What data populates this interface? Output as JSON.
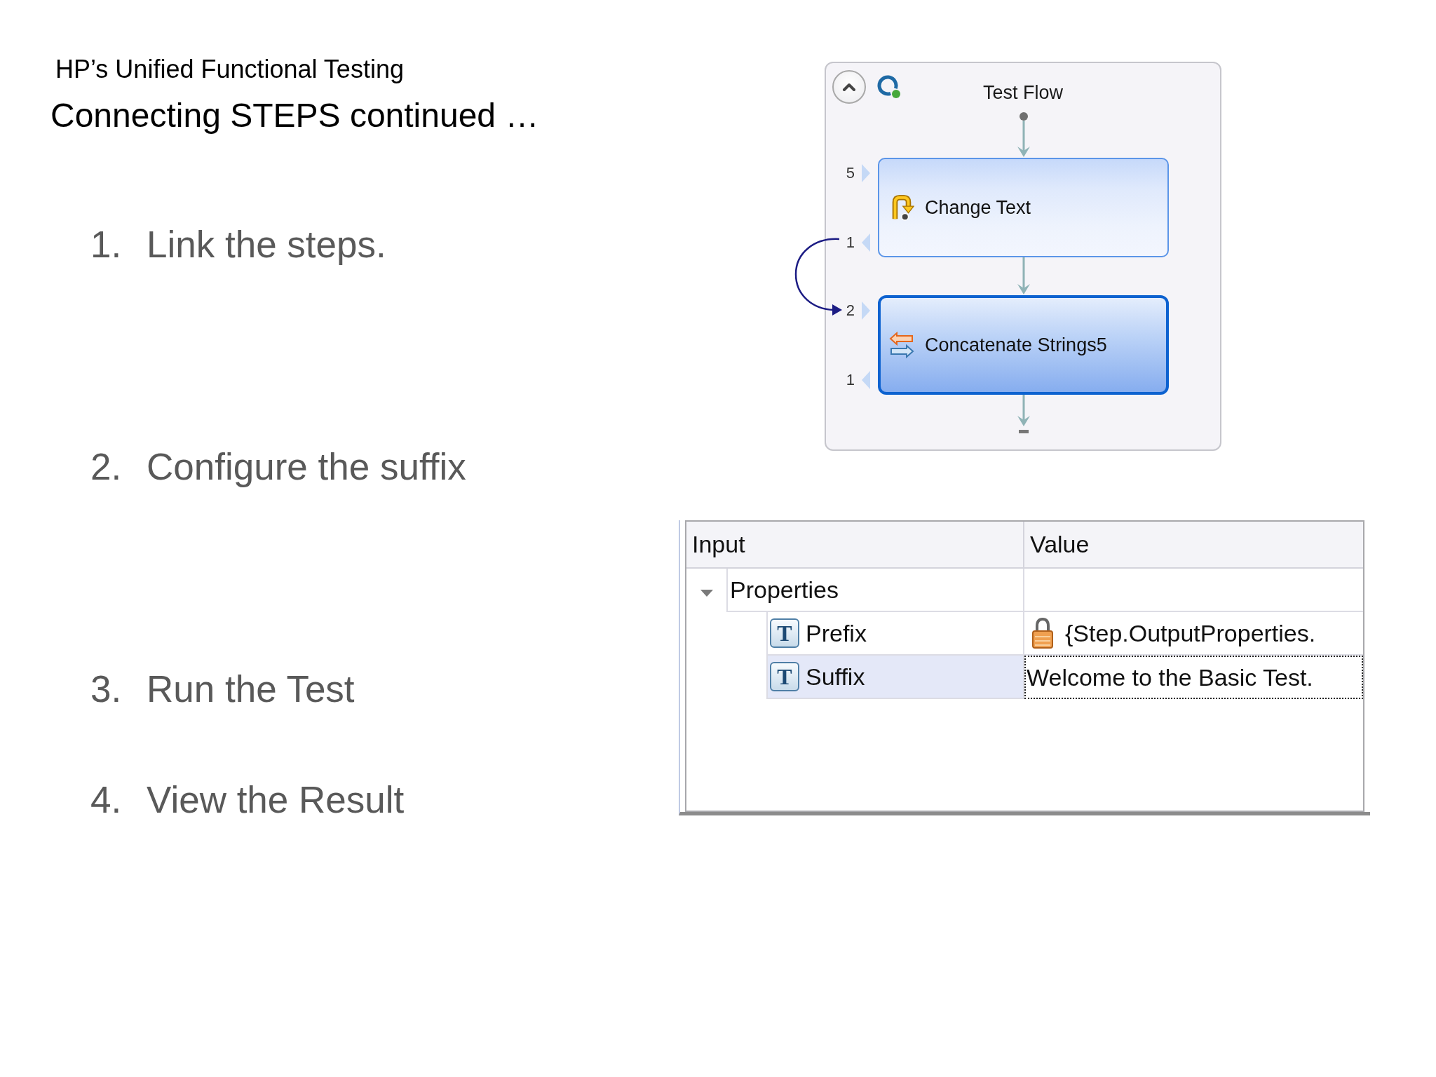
{
  "header": {
    "subtitle": "HP’s Unified Functional Testing",
    "title": "Connecting STEPS continued …"
  },
  "steps": [
    {
      "number": "1.",
      "text": "Link the steps."
    },
    {
      "number": "2.",
      "text": "Configure the suffix"
    },
    {
      "number": "3.",
      "text": "Run the Test"
    },
    {
      "number": "4.",
      "text": "View the Result"
    }
  ],
  "test_flow": {
    "title": "Test Flow",
    "data_link": true,
    "nodes": [
      {
        "kind": "change",
        "label": "Change Text",
        "in_count": "5",
        "out_count": "1",
        "selected": false
      },
      {
        "kind": "concatenate",
        "label": "Concatenate Strings5",
        "in_count": "2",
        "out_count": "1",
        "selected": true
      }
    ]
  },
  "properties": {
    "columns": [
      "Input",
      "Value"
    ],
    "rows": [
      {
        "label": "Properties",
        "expanded": true,
        "selected": false,
        "children": [
          {
            "type_icon": "T",
            "label": "Prefix",
            "value": "{Step.OutputProperties.",
            "locked": true,
            "selected": false
          },
          {
            "type_icon": "T",
            "label": "Suffix",
            "value": "Welcome to the Basic Test.",
            "locked": false,
            "selected": true
          }
        ]
      }
    ]
  }
}
